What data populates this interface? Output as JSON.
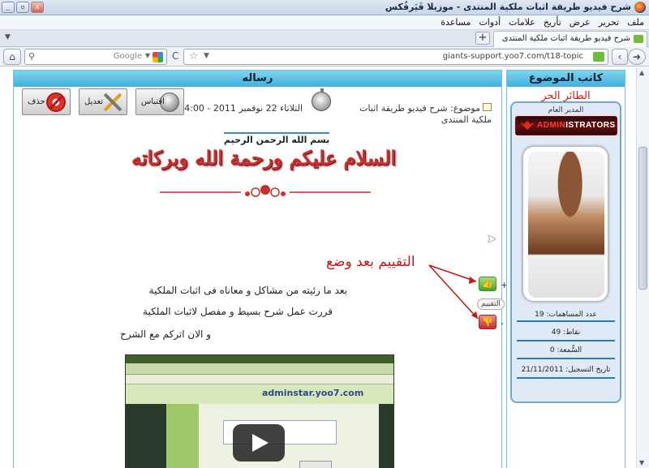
{
  "window": {
    "title": "شرح فيديو طريقة اثبات ملكية المنتدى - موزيلا فَيَرفُكس",
    "buttons": {
      "minimize": "_",
      "maximize": "▫",
      "close": "x"
    }
  },
  "menu": [
    "ملف",
    "تحرير",
    "عرض",
    "تأريخ",
    "علامات",
    "أدوات",
    "مساعدة"
  ],
  "tabs": [
    {
      "label": "شرح فيديو طريقة اثبات ملكية المنتدى"
    }
  ],
  "tab_new": "+",
  "nav": {
    "url": "giants-support.yoo7.com/t18-topic",
    "search_placeholder": "Google"
  },
  "post": {
    "header": "رساله",
    "buttons": {
      "quote": "اقتباس",
      "edit": "تعديل",
      "delete": "حذف"
    },
    "topic": "موضوع: شرح فيديو طريقة اثبات ملكية المنتدى",
    "date": "الثلاثاء 22 نوفمبر 2011 - 4:00",
    "basmala": "بسم الله الرحمن الرحيم",
    "salam": "السلام عليكم ورحمة الله وبركاته",
    "annotation": "التقييم بعد وضع",
    "rating_label": "التقييم",
    "rating_plus": "+",
    "rating_minus": "-",
    "lines": [
      "بعد ما رئيته من مشاكل و معاناه فى اثبات الملكية",
      "قررت عمل شرح بسيط و مفصل لاثبات الملكية",
      "و الان اتركم مع الشرح"
    ],
    "thumbnail_site": "adminstar.yoo7.com"
  },
  "author": {
    "header": "كاتب الموضوع",
    "name": "الطائر الحر",
    "role": "المدير العام",
    "rank_prefix": "ADMIN",
    "rank_suffix": "ISTRATORS",
    "stats": {
      "posts": "عدد المساهمات: 19",
      "points": "نقاط: 49",
      "reputation": "السٌّمعة: 0",
      "registered": "تاريخ التسجيل: 21/11/2011"
    }
  },
  "colors": {
    "accent": "#3fb1dc",
    "annotation": "#c81414",
    "salam": "#c72f30"
  }
}
